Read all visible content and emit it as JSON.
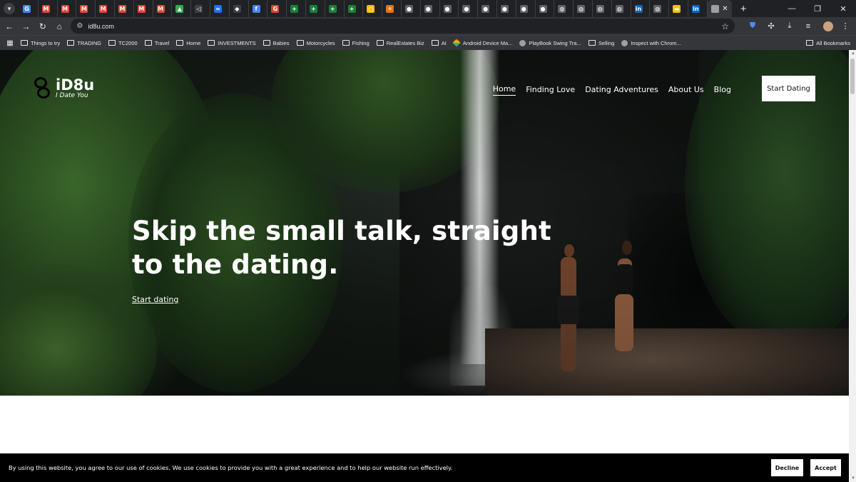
{
  "browser": {
    "tab_favicons": [
      "G",
      "M",
      "M",
      "M",
      "M",
      "M",
      "M",
      "M",
      "▲",
      "◁",
      "≈",
      "◆",
      "f",
      "G",
      "+",
      "+",
      "+",
      "+",
      "○",
      "✳",
      "●",
      "●",
      "●",
      "●",
      "●",
      "●",
      "●",
      "●",
      "◍",
      "◍",
      "◍",
      "◍",
      "in",
      "◍",
      "▬",
      "in"
    ],
    "tab_close": "✕",
    "new_tab": "+",
    "url": "id8u.com",
    "window_controls": {
      "minimize": "—",
      "restore": "❐",
      "close": "✕"
    }
  },
  "bookmarks": {
    "items": [
      {
        "label": "Things to try",
        "kind": "folder"
      },
      {
        "label": "TRADING",
        "kind": "folder"
      },
      {
        "label": "TC2000",
        "kind": "folder"
      },
      {
        "label": "Travel",
        "kind": "folder"
      },
      {
        "label": "Home",
        "kind": "folder"
      },
      {
        "label": "INVESTMENTS",
        "kind": "folder"
      },
      {
        "label": "Babies",
        "kind": "folder"
      },
      {
        "label": "Motorcycles",
        "kind": "folder"
      },
      {
        "label": "Fishing",
        "kind": "folder"
      },
      {
        "label": "RealEstates Biz",
        "kind": "folder"
      },
      {
        "label": "AI",
        "kind": "folder"
      },
      {
        "label": "Android Device Ma...",
        "kind": "android"
      },
      {
        "label": "PlayBook Swing Tra...",
        "kind": "globe"
      },
      {
        "label": "Selling",
        "kind": "folder"
      },
      {
        "label": "Inspect with Chrom...",
        "kind": "globe"
      }
    ],
    "all_bookmarks": "All Bookmarks"
  },
  "site": {
    "logo": {
      "name": "iD8u",
      "tagline": "I Date You"
    },
    "nav": [
      {
        "label": "Home",
        "active": true
      },
      {
        "label": "Finding Love",
        "active": false
      },
      {
        "label": "Dating Adventures",
        "active": false
      },
      {
        "label": "About Us",
        "active": false
      },
      {
        "label": "Blog",
        "active": false
      }
    ],
    "cta": "Start Dating",
    "headline": "Skip the small talk, straight to the dating.",
    "hero_link": "Start dating"
  },
  "cookie": {
    "text": "By using this website, you agree to our use of cookies. We use cookies to provide you with a great experience and to help our website run effectively.",
    "decline": "Decline",
    "accept": "Accept"
  },
  "colors": {
    "accent_pink": "#e23c9c",
    "accent_blue": "#4fa0ff",
    "chrome_bg": "#202124"
  }
}
